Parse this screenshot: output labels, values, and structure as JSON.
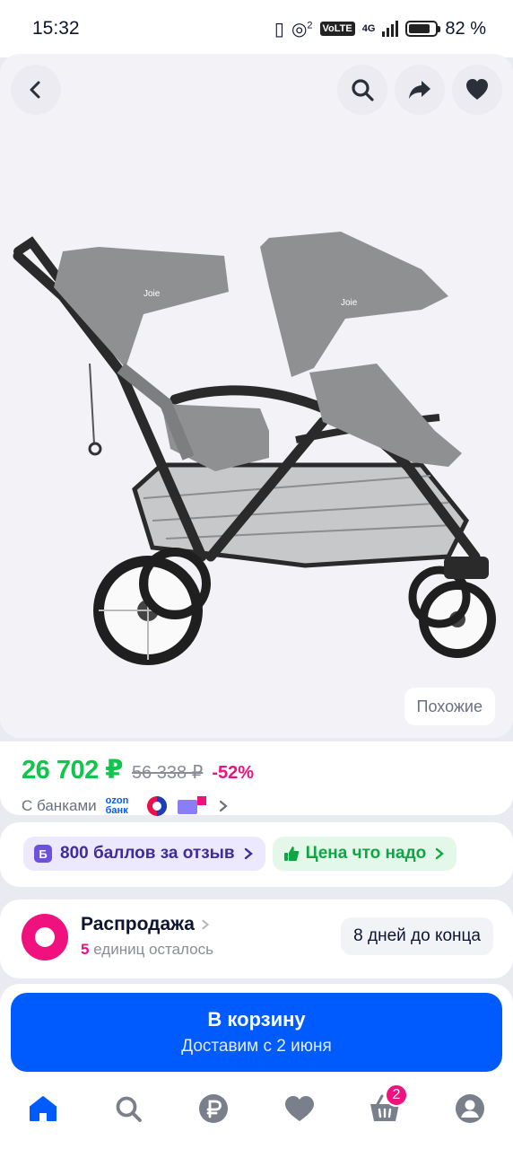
{
  "status_bar": {
    "time": "15:32",
    "data_badge": "2",
    "volte": "VoLTE",
    "network": "4G",
    "battery": "82 %"
  },
  "gallery": {
    "similar_label": "Похожие",
    "icons": {
      "back": "chevron-left-icon",
      "search": "search-icon",
      "share": "share-icon",
      "favorite": "heart-icon"
    },
    "image_brand": "Joie"
  },
  "price": {
    "current": "26 702 ₽",
    "old": "56 338 ₽",
    "discount": "-52%",
    "banks_label": "С банками",
    "ozon_bank": "ozon банк"
  },
  "promo": {
    "points_badge": "Б",
    "points_label": "800 баллов за отзыв",
    "price_label": "Цена что надо"
  },
  "sale": {
    "title": "Распродажа",
    "units": "5",
    "units_suffix": "единиц осталось",
    "days_left": "8 дней до конца"
  },
  "cart": {
    "title": "В корзину",
    "subtitle": "Доставим с 2 июня"
  },
  "tabbar": {
    "items": [
      {
        "icon": "home-icon",
        "active": true
      },
      {
        "icon": "search-icon"
      },
      {
        "icon": "ruble-icon"
      },
      {
        "icon": "heart-icon"
      },
      {
        "icon": "basket-icon",
        "badge": "2"
      },
      {
        "icon": "profile-icon"
      }
    ]
  },
  "colors": {
    "accent_blue": "#005bff",
    "price_green": "#10c44c",
    "pink": "#f1117e"
  }
}
